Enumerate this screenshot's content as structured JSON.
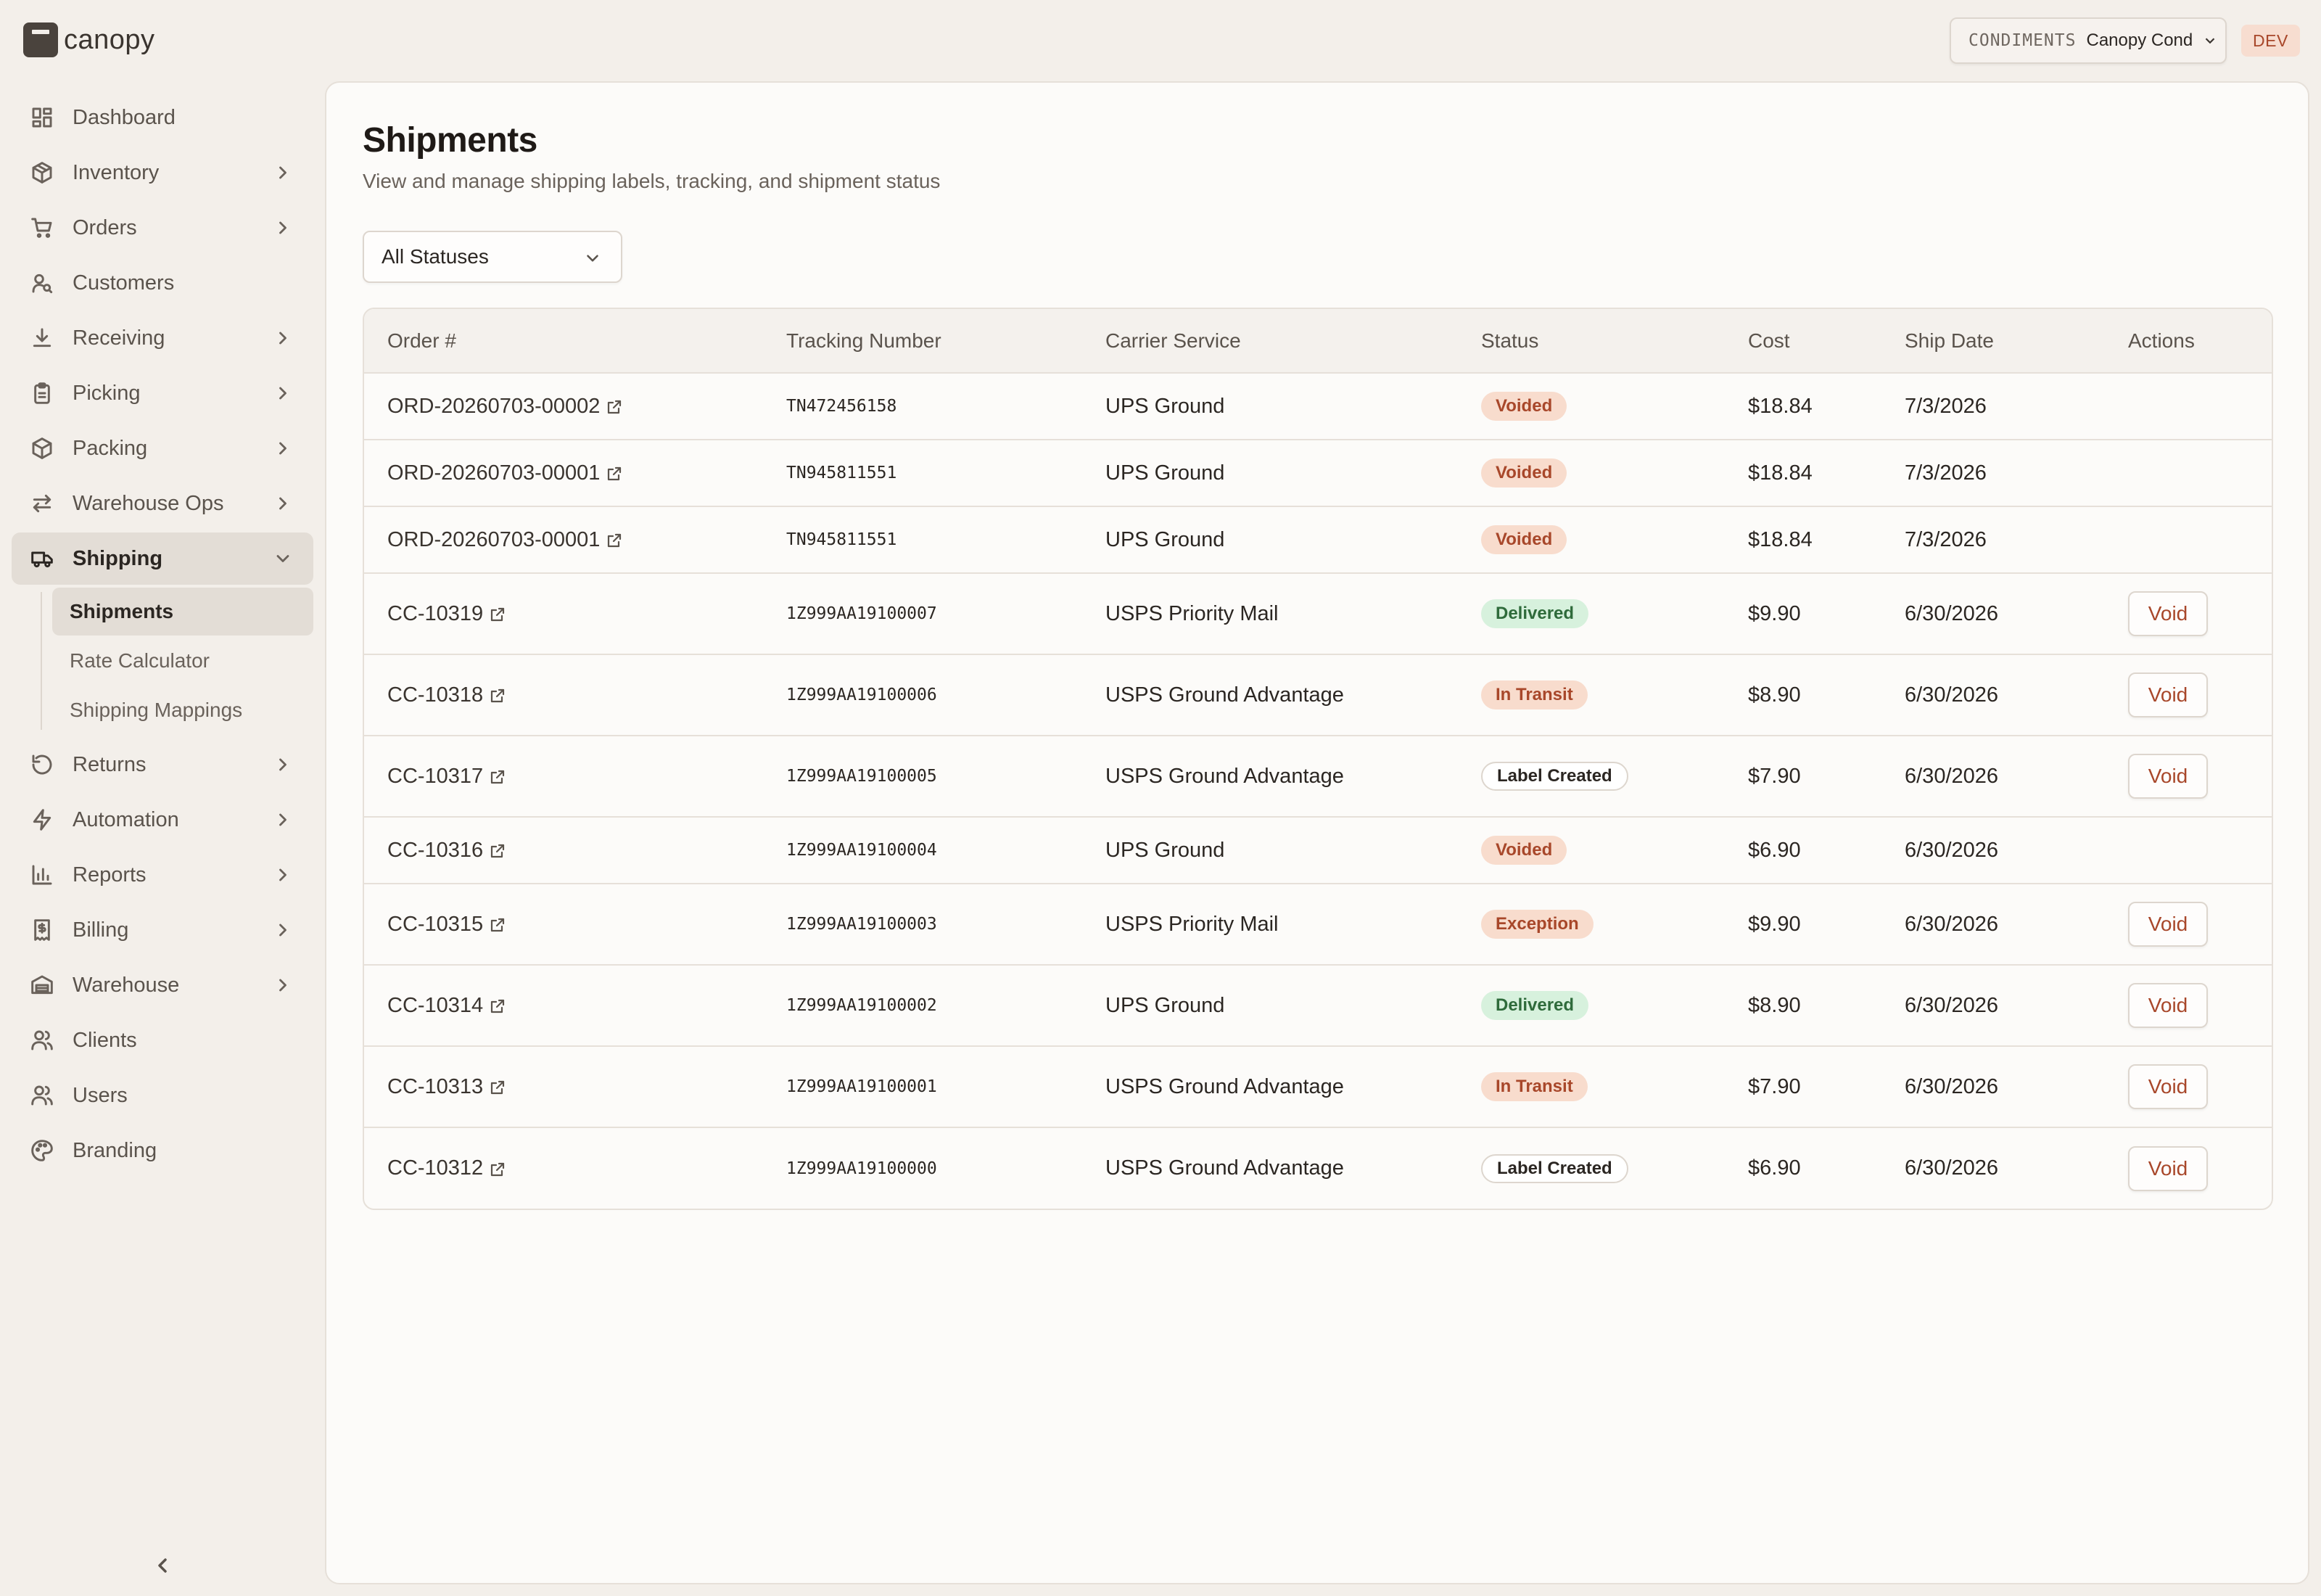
{
  "brand": {
    "name": "canopy"
  },
  "tenant": {
    "code": "CONDIMENTS",
    "name": "Canopy Cond"
  },
  "env_badge": "DEV",
  "nav": [
    {
      "label": "Dashboard",
      "icon": "dashboard-icon",
      "chevron": false
    },
    {
      "label": "Inventory",
      "icon": "box-icon",
      "chevron": true
    },
    {
      "label": "Orders",
      "icon": "cart-icon",
      "chevron": true
    },
    {
      "label": "Customers",
      "icon": "customer-icon",
      "chevron": false
    },
    {
      "label": "Receiving",
      "icon": "download-icon",
      "chevron": true
    },
    {
      "label": "Picking",
      "icon": "clipboard-icon",
      "chevron": true
    },
    {
      "label": "Packing",
      "icon": "package-icon",
      "chevron": true
    },
    {
      "label": "Warehouse Ops",
      "icon": "swap-icon",
      "chevron": true
    },
    {
      "label": "Shipping",
      "icon": "truck-icon",
      "chevron": "down",
      "active": true
    },
    {
      "label": "Returns",
      "icon": "rotate-icon",
      "chevron": true
    },
    {
      "label": "Automation",
      "icon": "bolt-icon",
      "chevron": true
    },
    {
      "label": "Reports",
      "icon": "bar-chart-icon",
      "chevron": true
    },
    {
      "label": "Billing",
      "icon": "receipt-icon",
      "chevron": true
    },
    {
      "label": "Warehouse",
      "icon": "warehouse-icon",
      "chevron": true
    },
    {
      "label": "Clients",
      "icon": "users-icon",
      "chevron": false
    },
    {
      "label": "Users",
      "icon": "users-icon",
      "chevron": false
    },
    {
      "label": "Branding",
      "icon": "palette-icon",
      "chevron": false
    }
  ],
  "shipping_subnav": [
    {
      "label": "Shipments",
      "active": true
    },
    {
      "label": "Rate Calculator"
    },
    {
      "label": "Shipping Mappings"
    }
  ],
  "page": {
    "title": "Shipments",
    "subtitle": "View and manage shipping labels, tracking, and shipment status"
  },
  "filter": {
    "selected": "All Statuses"
  },
  "table": {
    "headers": [
      "Order #",
      "Tracking Number",
      "Carrier Service",
      "Status",
      "Cost",
      "Ship Date",
      "Actions"
    ],
    "action_label": "Void",
    "rows": [
      {
        "order": "ORD-20260703-00002",
        "tracking": "TN472456158",
        "service": "UPS Ground",
        "status": "Voided",
        "status_kind": "voided",
        "cost": "$18.84",
        "date": "7/3/2026",
        "void": false
      },
      {
        "order": "ORD-20260703-00001",
        "tracking": "TN945811551",
        "service": "UPS Ground",
        "status": "Voided",
        "status_kind": "voided",
        "cost": "$18.84",
        "date": "7/3/2026",
        "void": false
      },
      {
        "order": "ORD-20260703-00001",
        "tracking": "TN945811551",
        "service": "UPS Ground",
        "status": "Voided",
        "status_kind": "voided",
        "cost": "$18.84",
        "date": "7/3/2026",
        "void": false
      },
      {
        "order": "CC-10319",
        "tracking": "1Z999AA19100007",
        "service": "USPS Priority Mail",
        "status": "Delivered",
        "status_kind": "delivered",
        "cost": "$9.90",
        "date": "6/30/2026",
        "void": true
      },
      {
        "order": "CC-10318",
        "tracking": "1Z999AA19100006",
        "service": "USPS Ground Advantage",
        "status": "In Transit",
        "status_kind": "transit",
        "cost": "$8.90",
        "date": "6/30/2026",
        "void": true
      },
      {
        "order": "CC-10317",
        "tracking": "1Z999AA19100005",
        "service": "USPS Ground Advantage",
        "status": "Label Created",
        "status_kind": "created",
        "cost": "$7.90",
        "date": "6/30/2026",
        "void": true
      },
      {
        "order": "CC-10316",
        "tracking": "1Z999AA19100004",
        "service": "UPS Ground",
        "status": "Voided",
        "status_kind": "voided",
        "cost": "$6.90",
        "date": "6/30/2026",
        "void": false
      },
      {
        "order": "CC-10315",
        "tracking": "1Z999AA19100003",
        "service": "USPS Priority Mail",
        "status": "Exception",
        "status_kind": "exception",
        "cost": "$9.90",
        "date": "6/30/2026",
        "void": true
      },
      {
        "order": "CC-10314",
        "tracking": "1Z999AA19100002",
        "service": "UPS Ground",
        "status": "Delivered",
        "status_kind": "delivered",
        "cost": "$8.90",
        "date": "6/30/2026",
        "void": true
      },
      {
        "order": "CC-10313",
        "tracking": "1Z999AA19100001",
        "service": "USPS Ground Advantage",
        "status": "In Transit",
        "status_kind": "transit",
        "cost": "$7.90",
        "date": "6/30/2026",
        "void": true
      },
      {
        "order": "CC-10312",
        "tracking": "1Z999AA19100000",
        "service": "USPS Ground Advantage",
        "status": "Label Created",
        "status_kind": "created",
        "cost": "$6.90",
        "date": "6/30/2026",
        "void": true
      }
    ]
  }
}
